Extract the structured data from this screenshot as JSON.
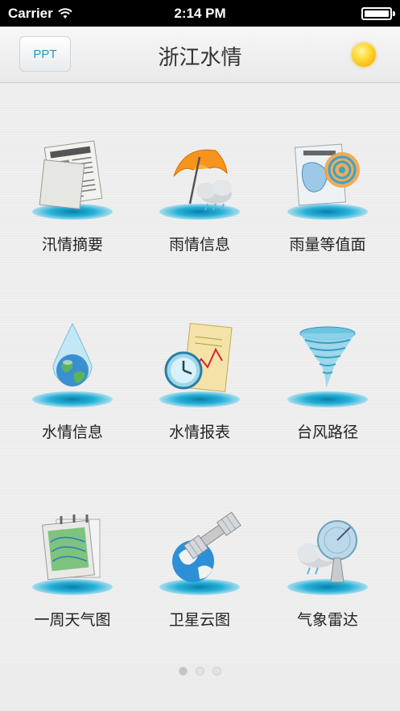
{
  "status_bar": {
    "carrier": "Carrier",
    "time": "2:14 PM"
  },
  "nav": {
    "left_button": "PPT",
    "title": "浙江水情",
    "right_icon": "sun-icon"
  },
  "tiles": [
    {
      "label": "汛情摘要",
      "icon": "newspaper-icon"
    },
    {
      "label": "雨情信息",
      "icon": "umbrella-cloud-icon"
    },
    {
      "label": "雨量等值面",
      "icon": "rainfall-contour-icon"
    },
    {
      "label": "水情信息",
      "icon": "water-drop-globe-icon"
    },
    {
      "label": "水情报表",
      "icon": "report-clock-icon"
    },
    {
      "label": "台风路径",
      "icon": "typhoon-icon"
    },
    {
      "label": "一周天气图",
      "icon": "weather-calendar-icon"
    },
    {
      "label": "卫星云图",
      "icon": "satellite-icon"
    },
    {
      "label": "气象雷达",
      "icon": "radar-dish-icon"
    }
  ],
  "page_dots": {
    "count": 3,
    "active": 1
  }
}
